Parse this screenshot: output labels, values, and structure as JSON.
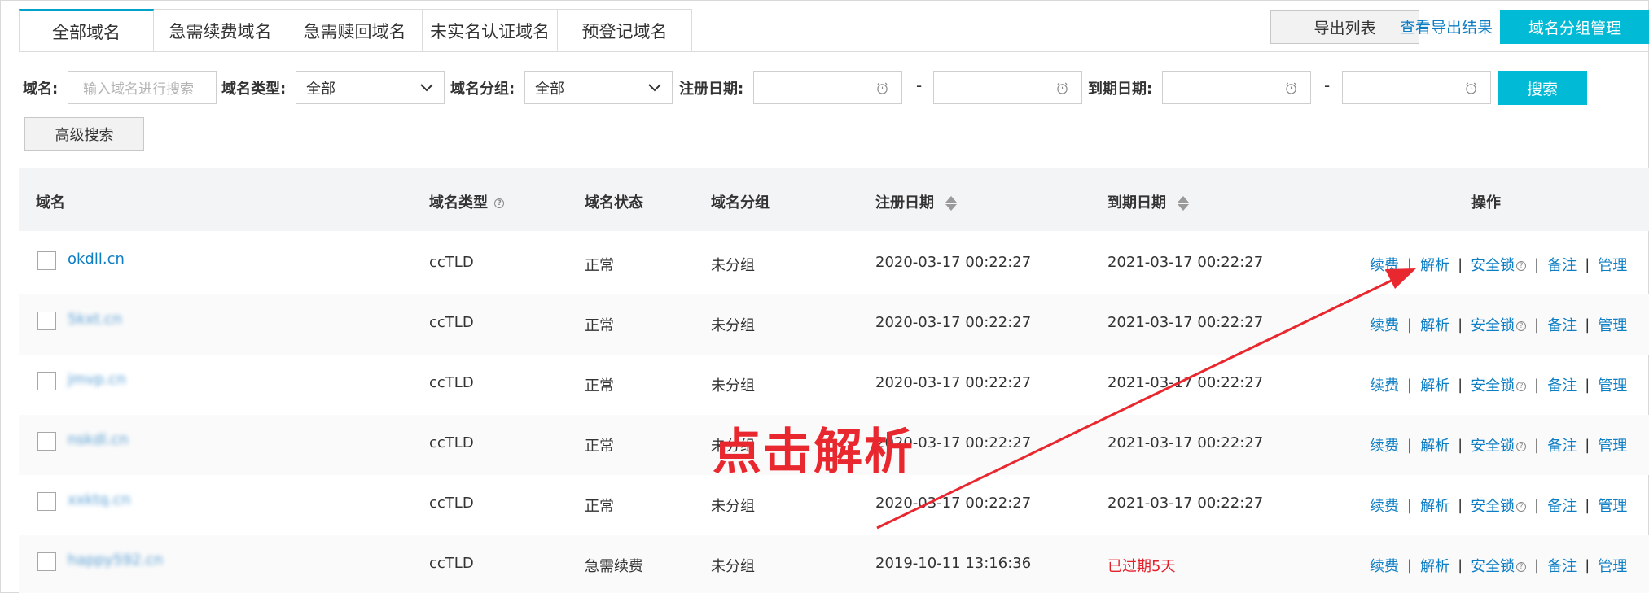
{
  "tabs": [
    "全部域名",
    "急需续费域名",
    "急需赎回域名",
    "未实名认证域名",
    "预登记域名"
  ],
  "toolbar": {
    "export_list": "导出列表",
    "view_export_result": "查看导出结果",
    "group_manage": "域名分组管理"
  },
  "filters": {
    "domain_label": "域名:",
    "domain_placeholder": "输入域名进行搜索",
    "type_label": "域名类型:",
    "type_value": "全部",
    "group_label": "域名分组:",
    "group_value": "全部",
    "reg_date_label": "注册日期:",
    "exp_date_label": "到期日期:",
    "dash": "-",
    "search_button": "搜索",
    "advanced_button": "高级搜索"
  },
  "table": {
    "headers": {
      "domain": "域名",
      "type": "域名类型",
      "status": "域名状态",
      "group": "域名分组",
      "reg_date": "注册日期",
      "exp_date": "到期日期",
      "actions": "操作"
    },
    "actions": {
      "renew": "续费",
      "resolve": "解析",
      "lock": "安全锁",
      "note": "备注",
      "manage": "管理",
      "sep": "|"
    },
    "rows": [
      {
        "domain": "okdll.cn",
        "type": "ccTLD",
        "status": "正常",
        "group": "未分组",
        "reg": "2020-03-17 00:22:27",
        "exp": "2021-03-17 00:22:27"
      },
      {
        "domain": "5kxt.cn",
        "type": "ccTLD",
        "status": "正常",
        "group": "未分组",
        "reg": "2020-03-17 00:22:27",
        "exp": "2021-03-17 00:22:27"
      },
      {
        "domain": "jmvp.cn",
        "type": "ccTLD",
        "status": "正常",
        "group": "未分组",
        "reg": "2020-03-17 00:22:27",
        "exp": "2021-03-17 00:22:27"
      },
      {
        "domain": "nskdl.cn",
        "type": "ccTLD",
        "status": "正常",
        "group": "未分组",
        "reg": "2020-03-17 00:22:27",
        "exp": "2021-03-17 00:22:27"
      },
      {
        "domain": "xxktq.cn",
        "type": "ccTLD",
        "status": "正常",
        "group": "未分组",
        "reg": "2020-03-17 00:22:27",
        "exp": "2021-03-17 00:22:27"
      },
      {
        "domain": "happy592.cn",
        "type": "ccTLD",
        "status": "急需续费",
        "group": "未分组",
        "reg": "2019-10-11 13:16:36",
        "exp": "已过期5天"
      }
    ]
  },
  "annotation": {
    "text": "点击解析",
    "color": "#e8282e"
  },
  "colors": {
    "accent": "#00bad6",
    "link": "#0e7ec4",
    "danger": "#e4202b"
  }
}
